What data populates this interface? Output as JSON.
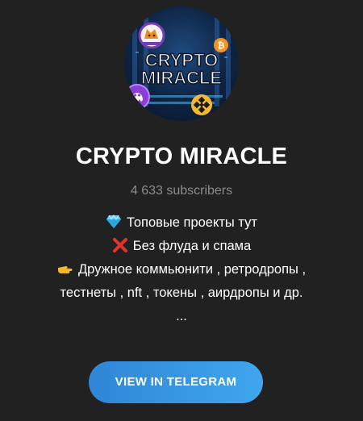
{
  "channel": {
    "title": "CRYPTO MIRACLE",
    "subscribers": "4 633 subscribers",
    "avatar": {
      "text_line1": "CRYPTO",
      "text_line2": "MIRACLE",
      "icons": [
        "shiba-coin-icon",
        "bitcoin-icon",
        "binance-coin-icon",
        "purple-token-icon"
      ]
    },
    "description": {
      "line1_icon": "diamond-icon",
      "line1": "Топовые проекты тут",
      "line2_icon": "cross-mark-icon",
      "line2": "Без флуда и спама",
      "line3_icon": "pointing-hand-icon",
      "line3": "Дружное коммьюнити , ретродропы ,",
      "line4": "тестнеты , nft , токены , аирдропы и др.",
      "line5": "..."
    }
  },
  "actions": {
    "view_button_label": "VIEW IN TELEGRAM"
  },
  "colors": {
    "background": "#212121",
    "button_start": "#2f86d6",
    "button_end": "#3fa6ee",
    "muted_text": "#8c8c8c"
  }
}
